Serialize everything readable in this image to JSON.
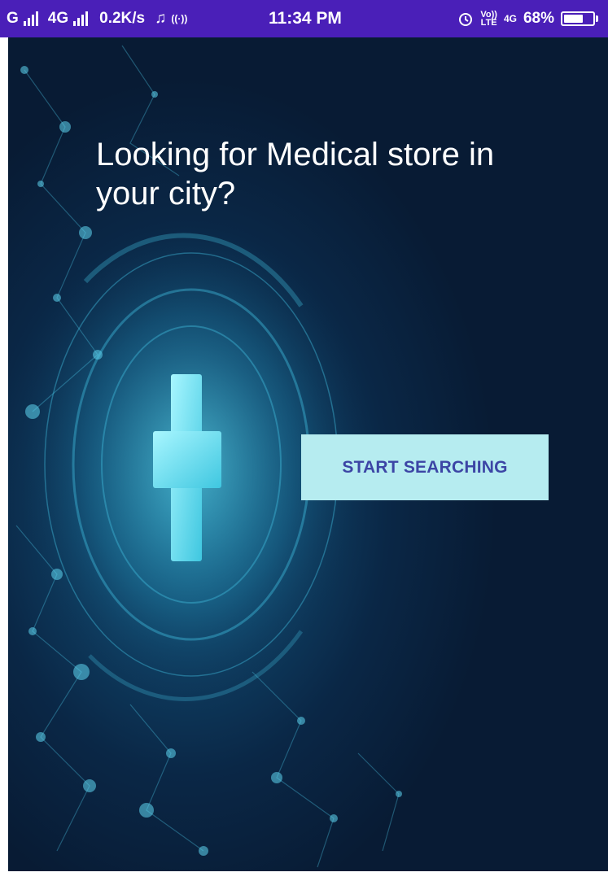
{
  "status_bar": {
    "network_1": "G",
    "network_2": "4G",
    "speed": "0.2K/s",
    "time": "11:34 PM",
    "volte_top": "Vo))",
    "volte_bottom": "LTE",
    "network_3": "4G",
    "battery_percent": "68%",
    "battery_level": 0.68
  },
  "main": {
    "headline": "Looking for Medical store in your city?",
    "start_button_label": "START SEARCHING"
  },
  "colors": {
    "status_bar": "#4a1fb8",
    "button_bg": "#b6ecf0",
    "button_text": "#3c45a5",
    "background": "#0a2746"
  },
  "icons": [
    "signal-icon",
    "music-note-icon",
    "hotspot-icon",
    "alarm-icon",
    "battery-icon",
    "medical-cross-icon"
  ]
}
